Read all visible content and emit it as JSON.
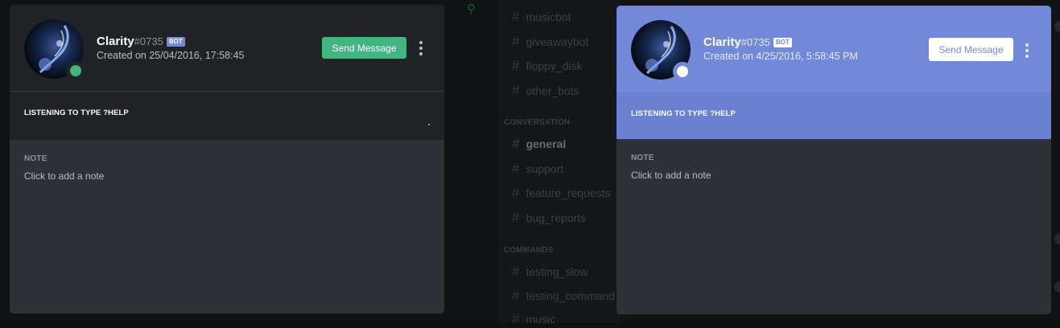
{
  "background": {
    "channels": [
      {
        "name": "musicbot",
        "active": false
      },
      {
        "name": "giveawaybot",
        "active": false
      },
      {
        "name": "floppy_disk",
        "active": false
      },
      {
        "name": "other_bots",
        "active": false
      },
      {
        "name": "general",
        "active": true
      },
      {
        "name": "support",
        "active": false
      },
      {
        "name": "feature_requests",
        "active": false
      },
      {
        "name": "bug_reports",
        "active": false
      },
      {
        "name": "testing_slow",
        "active": false
      },
      {
        "name": "testing_command",
        "active": false
      },
      {
        "name": "music",
        "active": false
      }
    ],
    "categories": {
      "conversation": "CONVERSATION",
      "commands": "COMMANDS"
    },
    "hash_glyph": "#",
    "search_icon": "search-icon"
  },
  "popout_dark": {
    "theme": "dark",
    "username": "Clarity",
    "discriminator": "#0735",
    "bot_tag": "BOT",
    "created": "Created on 25/04/2016, 17:58:45",
    "send_message_label": "Send Message",
    "activity": "LISTENING TO TYPE ?HELP",
    "note_title": "NOTE",
    "note_placeholder": "Click to add a note",
    "status_color": "#43b581",
    "button_color": "#43b581"
  },
  "popout_light": {
    "theme": "blurple",
    "username": "Clarity",
    "discriminator": "#0735",
    "bot_tag": "BOT",
    "created": "Created on 4/25/2016, 5:58:45 PM",
    "send_message_label": "Send Message",
    "activity": "LISTENING TO TYPE ?HELP",
    "note_title": "NOTE",
    "note_placeholder": "Click to add a note",
    "header_color": "#7289da",
    "status_color": "#ffffff"
  }
}
